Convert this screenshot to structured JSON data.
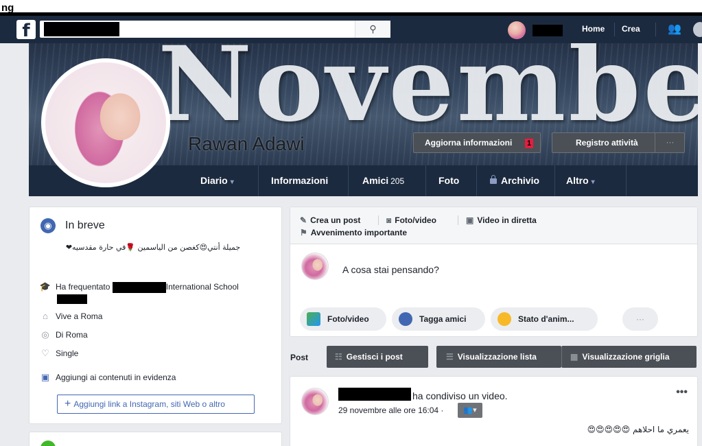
{
  "window": {
    "cut_title": "ng"
  },
  "header": {
    "search_icon": "magnifier-icon",
    "links": [
      "Home",
      "Crea"
    ],
    "friends_icon": "friends-icon"
  },
  "cover": {
    "art_word": "November",
    "profile_name": "Rawan Adawi",
    "update_info_label": "Aggiorna informazioni",
    "update_info_badge": "1",
    "activity_log_label": "Registro attività",
    "more_label": "···"
  },
  "profile_nav": {
    "items": [
      {
        "label": "Diario",
        "caret": "▾"
      },
      {
        "label": "Informazioni"
      },
      {
        "label": "Amici",
        "count": "205"
      },
      {
        "label": "Foto"
      },
      {
        "label": "Archivio"
      },
      {
        "label": "Altro",
        "caret": "▾"
      }
    ]
  },
  "intro": {
    "title": "In breve",
    "bio": "جميلة أنتي😍كغصن من الياسمين 🌹في حارة مقدسيه❤",
    "studied_prefix": "Ha frequentato",
    "studied_suffix": "International School",
    "lives_in": "Vive a Roma",
    "from": "Di Roma",
    "relationship": "Single",
    "add_featured": "Aggiungi ai contenuti in evidenza",
    "add_link_button": "Aggiungi link a Instagram, siti Web o altro"
  },
  "composer": {
    "tabs": {
      "create_post": "Crea un post",
      "photo_video": "Foto/video",
      "live_video": "Video in diretta",
      "life_event": "Avvenimento importante"
    },
    "placeholder": "A cosa stai pensando?",
    "pills": {
      "photo_video": "Foto/video",
      "tag_friends": "Tagga amici",
      "feeling": "Stato d'anim..."
    },
    "more": "···"
  },
  "post_toolbar": {
    "label": "Post",
    "manage_posts": "Gestisci i post",
    "list_view": "Visualizzazione lista",
    "grid_view": "Visualizzazione griglia"
  },
  "feed_post": {
    "action": "ha condiviso un video.",
    "timestamp": "29 novembre alle ore 16:04 ·",
    "text": "يعمري ما احلاهم 😍😍😍😍😍",
    "menu": "•••"
  }
}
